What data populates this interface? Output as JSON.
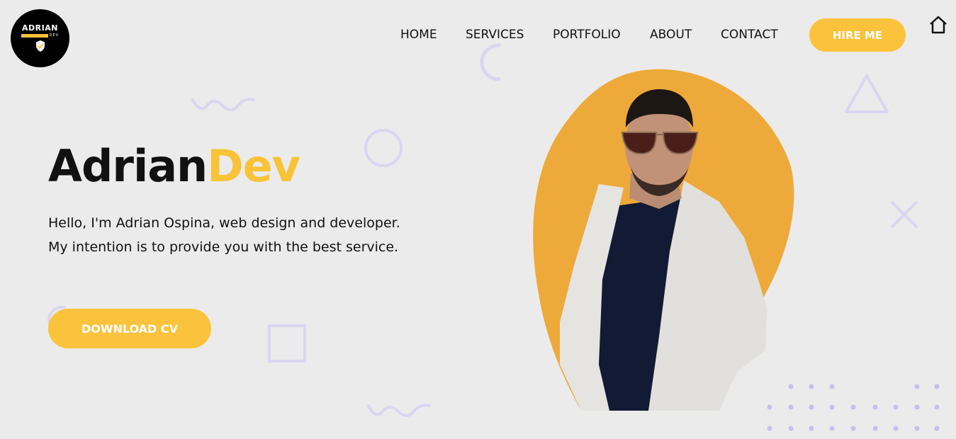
{
  "logo": {
    "top": "ADRIAN",
    "sub": "DEV"
  },
  "nav": {
    "items": [
      {
        "label": "HOME"
      },
      {
        "label": "SERVICES"
      },
      {
        "label": "PORTFOLIO"
      },
      {
        "label": "ABOUT"
      },
      {
        "label": "CONTACT"
      }
    ],
    "hire_label": "HIRE ME"
  },
  "hero": {
    "title_main": "Adrian",
    "title_accent": "Dev",
    "description": "Hello, I'm Adrian Ospina, web design and developer. My intention is to provide you with the best service.",
    "cv_label": "DOWNLOAD CV"
  },
  "colors": {
    "accent": "#fbc33c",
    "blob": "#edaa3a",
    "decor": "#d9d6f0",
    "background": "#ebebeb"
  },
  "icons": [
    "home-icon",
    "shield-check-icon"
  ]
}
